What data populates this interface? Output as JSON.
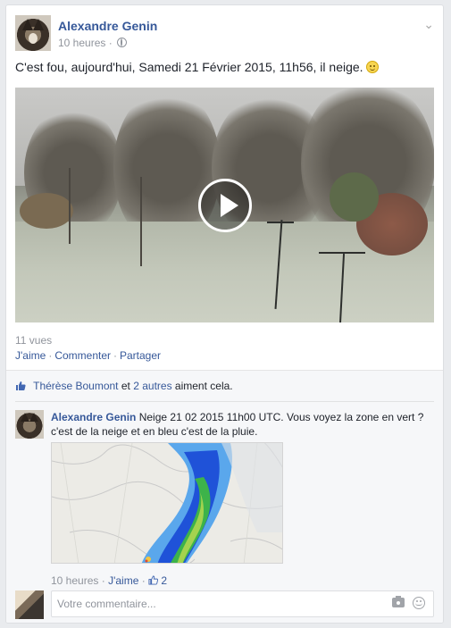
{
  "post": {
    "author": "Alexandre Genin",
    "time": "10 heures",
    "separator": "·",
    "text": "C'est fou, aujourd'hui, Samedi 21 Février 2015, 11h56, il neige.",
    "views": "11 vues"
  },
  "actions": {
    "like": "J'aime",
    "comment": "Commenter",
    "share": "Partager",
    "dot": "·"
  },
  "likes": {
    "person": "Thérèse Boumont",
    "connector": "et",
    "others": "2 autres",
    "suffix": "aiment cela."
  },
  "comment": {
    "author": "Alexandre Genin",
    "text": "Neige 21 02 2015 11h00 UTC. Vous voyez la zone en vert ? c'est de la neige et en bleu c'est de la pluie.",
    "time": "10 heures",
    "dot": "·",
    "like": "J'aime",
    "like_count": "2"
  },
  "composer": {
    "placeholder": "Votre commentaire..."
  },
  "colors": {
    "link": "#365899",
    "muted": "#90949c"
  }
}
